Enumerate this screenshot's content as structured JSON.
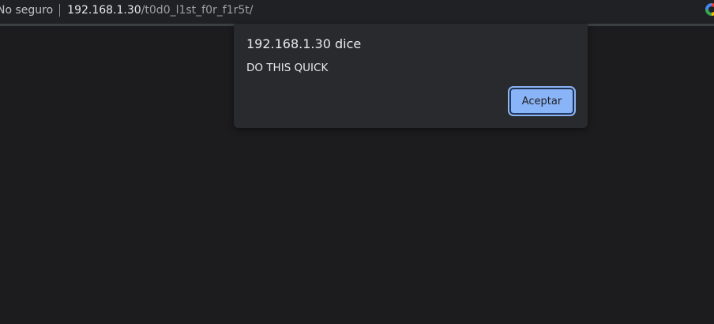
{
  "browser": {
    "security_label": "No seguro",
    "url_host": "192.168.1.30",
    "url_path": "/t0d0_l1st_f0r_f1r5t/"
  },
  "dialog": {
    "title": "192.168.1.30 dice",
    "message": "DO THIS QUICK",
    "ok_label": "Aceptar"
  },
  "colors": {
    "page_background": "#1c1c1e",
    "dialog_background": "#292a2d",
    "button_accent": "#8ab4f8"
  }
}
